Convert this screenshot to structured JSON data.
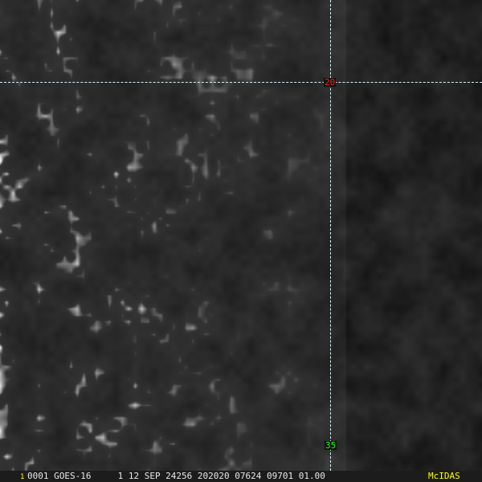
{
  "image": {
    "satellite": "GOES-16",
    "grid_color": "#d8f4f8"
  },
  "grid_labels": {
    "top_value": "20",
    "top_color": "#ff2020",
    "bottom_value": "35",
    "bottom_color": "#20ff20"
  },
  "status_bar": {
    "frame_number": "1",
    "info_text": "0001 GOES-16     1 12 SEP 24256 202020 07624 09701 01.00",
    "brand": "McIDAS",
    "brand_color": "#ffff00"
  }
}
